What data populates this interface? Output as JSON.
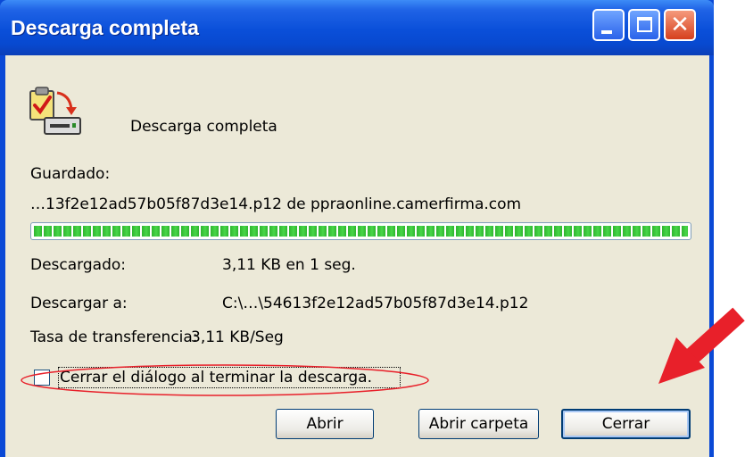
{
  "window": {
    "title": "Descarga completa",
    "controls": {
      "minimize": "minimize-icon",
      "maximize": "maximize-icon",
      "close": "close-icon",
      "close_glyph": "✕"
    }
  },
  "status": {
    "icon": "download-complete-icon",
    "heading": "Descarga completa"
  },
  "saved": {
    "label": "Guardado:",
    "file_line": "…13f2e12ad57b05f87d3e14.p12 de ppraonline.camerfirma.com"
  },
  "progress": {
    "fraction": 1.0
  },
  "details": {
    "downloaded_label": "Descargado:",
    "downloaded_value": "3,11 KB en 1 seg.",
    "download_to_label": "Descargar a:",
    "download_to_value": "C:\\…\\54613f2e12ad57b05f87d3e14.p12",
    "transfer_rate_label": "Tasa de transferencia:",
    "transfer_rate_value": "3,11 KB/Seg"
  },
  "option": {
    "close_on_finish_label": "Cerrar el diálogo al terminar la descarga.",
    "checked": false
  },
  "buttons": {
    "open": "Abrir",
    "open_folder": "Abrir carpeta",
    "close": "Cerrar"
  },
  "annotations": {
    "highlight_color": "#e8202a",
    "arrow_icon": "red-arrow-icon"
  },
  "colors": {
    "titlebar": "#0a4fd9",
    "dialog_face": "#ece9d8",
    "progress_fill": "#2fb52f"
  }
}
